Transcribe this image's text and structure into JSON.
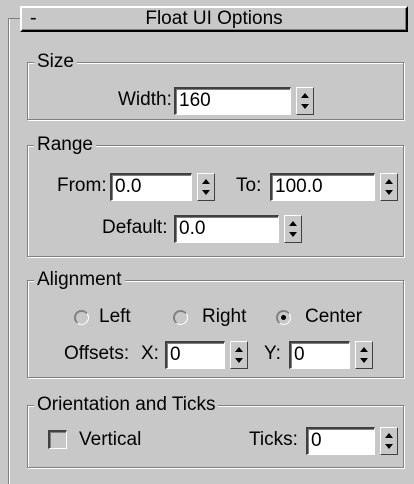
{
  "rollout": {
    "collapse_symbol": "-",
    "title": "Float UI Options"
  },
  "size": {
    "legend": "Size",
    "width_label": "Width:",
    "width_value": "160"
  },
  "range": {
    "legend": "Range",
    "from_label": "From:",
    "from_value": "0.0",
    "to_label": "To:",
    "to_value": "100.0",
    "default_label": "Default:",
    "default_value": "0.0"
  },
  "alignment": {
    "legend": "Alignment",
    "options": [
      {
        "label": "Left",
        "checked": false
      },
      {
        "label": "Right",
        "checked": false
      },
      {
        "label": "Center",
        "checked": true
      }
    ],
    "offsets_label": "Offsets:",
    "x_label": "X:",
    "x_value": "0",
    "y_label": "Y:",
    "y_value": "0"
  },
  "orientation": {
    "legend": "Orientation and Ticks",
    "vertical_label": "Vertical",
    "vertical_checked": false,
    "ticks_label": "Ticks:",
    "ticks_value": "0"
  }
}
